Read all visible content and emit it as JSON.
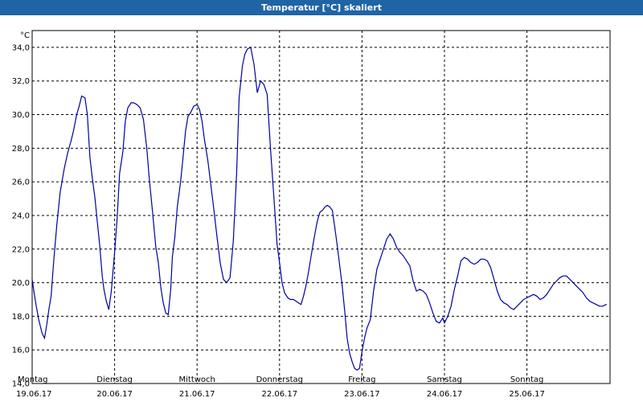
{
  "window": {
    "title": "Temperatur [°C] skaliert"
  },
  "chart_data": {
    "type": "line",
    "title": "Temperatur [°C] skaliert",
    "ylabel": "°C",
    "xlabel": "",
    "ylim": [
      14,
      35
    ],
    "yticks": [
      14,
      16,
      18,
      20,
      22,
      24,
      26,
      28,
      30,
      32,
      34
    ],
    "ytick_labels": [
      "14,0",
      "16,0",
      "18,0",
      "20,0",
      "22,0",
      "24,0",
      "26,0",
      "28,0",
      "30,0",
      "32,0",
      "34,0"
    ],
    "xlim": [
      0,
      7.0
    ],
    "x_unit": "days from 19.06.17 00:00",
    "days": [
      {
        "name": "Montag",
        "date": "19.06.17"
      },
      {
        "name": "Dienstag",
        "date": "20.06.17"
      },
      {
        "name": "Mittwoch",
        "date": "21.06.17"
      },
      {
        "name": "Donnerstag",
        "date": "22.06.17"
      },
      {
        "name": "Freitag",
        "date": "23.06.17"
      },
      {
        "name": "Samstag",
        "date": "24.06.17"
      },
      {
        "name": "Sonntag",
        "date": "25.06.17"
      }
    ],
    "grid": true,
    "grid_style": "dashed",
    "line_color": "#0000a0",
    "series": [
      {
        "x": [
          0.0,
          0.02,
          0.05,
          0.08,
          0.12,
          0.15,
          0.18,
          0.2,
          0.23,
          0.26,
          0.3,
          0.34,
          0.39,
          0.43,
          0.47,
          0.5,
          0.54,
          0.57,
          0.6,
          0.64,
          0.67,
          0.7,
          0.73,
          0.76,
          0.79,
          0.82,
          0.85,
          0.87,
          0.9,
          0.93,
          0.96,
          1.0,
          1.03,
          1.06,
          1.1,
          1.13,
          1.16,
          1.2,
          1.23,
          1.27,
          1.31,
          1.35,
          1.39,
          1.42,
          1.46,
          1.5,
          1.53,
          1.56,
          1.59,
          1.62,
          1.65,
          1.68,
          1.7,
          1.73,
          1.76,
          1.8,
          1.83,
          1.86,
          1.89,
          1.92,
          1.96,
          2.0,
          2.03,
          2.06,
          2.09,
          2.13,
          2.16,
          2.2,
          2.24,
          2.28,
          2.32,
          2.36,
          2.4,
          2.44,
          2.48,
          2.51,
          2.55,
          2.58,
          2.61,
          2.65,
          2.69,
          2.73,
          2.77,
          2.81,
          2.85,
          2.89,
          2.93,
          2.97,
          3.0,
          3.03,
          3.06,
          3.1,
          3.13,
          3.17,
          3.2,
          3.23,
          3.26,
          3.29,
          3.32,
          3.35,
          3.38,
          3.41,
          3.44,
          3.46,
          3.49,
          3.52,
          3.55,
          3.58,
          3.61,
          3.64,
          3.67,
          3.7,
          3.73,
          3.76,
          3.79,
          3.82,
          3.85,
          3.88,
          3.91,
          3.94,
          3.97,
          4.0,
          4.03,
          4.06,
          4.1,
          4.14,
          4.18,
          4.22,
          4.26,
          4.3,
          4.34,
          4.38,
          4.42,
          4.46,
          4.5,
          4.54,
          4.58,
          4.62,
          4.66,
          4.7,
          4.74,
          4.78,
          4.82,
          4.86,
          4.9,
          4.94,
          4.98,
          5.0,
          5.04,
          5.08,
          5.12,
          5.16,
          5.2,
          5.24,
          5.28,
          5.32,
          5.36,
          5.4,
          5.44,
          5.48,
          5.52,
          5.56,
          5.6,
          5.64,
          5.68,
          5.72,
          5.76,
          5.8,
          5.84,
          5.88,
          5.92,
          5.96,
          6.0,
          6.04,
          6.08,
          6.12,
          6.16,
          6.2,
          6.24,
          6.28,
          6.32,
          6.36,
          6.4,
          6.44,
          6.48,
          6.52,
          6.56,
          6.6,
          6.64,
          6.68,
          6.72,
          6.76,
          6.8,
          6.84,
          6.88,
          6.92,
          6.96,
          7.0
        ],
        "y": [
          20.2,
          19.5,
          18.6,
          17.8,
          17.0,
          16.7,
          17.6,
          18.3,
          19.2,
          21.2,
          23.5,
          25.4,
          26.8,
          27.7,
          28.4,
          29.0,
          30.0,
          30.5,
          31.1,
          31.0,
          30.0,
          27.5,
          26.2,
          25.1,
          23.6,
          22.2,
          20.4,
          19.6,
          18.9,
          18.4,
          19.5,
          21.8,
          23.8,
          26.5,
          27.8,
          29.6,
          30.4,
          30.7,
          30.7,
          30.6,
          30.4,
          29.7,
          28.0,
          26.2,
          24.2,
          22.1,
          21.2,
          19.7,
          18.8,
          18.2,
          18.1,
          19.6,
          21.5,
          22.7,
          24.5,
          26.0,
          27.5,
          29.0,
          29.9,
          30.1,
          30.5,
          30.6,
          30.3,
          29.6,
          28.5,
          27.3,
          26.1,
          24.5,
          22.8,
          21.2,
          20.2,
          20.0,
          20.3,
          22.5,
          26.5,
          31.0,
          32.9,
          33.6,
          33.9,
          34.0,
          33.0,
          31.3,
          32.0,
          31.8,
          31.2,
          28.0,
          25.2,
          22.3,
          21.2,
          20.0,
          19.4,
          19.1,
          19.0,
          19.0,
          18.9,
          18.8,
          18.7,
          19.2,
          19.8,
          20.6,
          21.5,
          22.4,
          23.2,
          23.7,
          24.2,
          24.3,
          24.5,
          24.6,
          24.5,
          24.3,
          23.3,
          22.2,
          21.0,
          19.8,
          18.3,
          16.7,
          15.8,
          15.3,
          14.9,
          14.8,
          14.9,
          15.9,
          16.7,
          17.3,
          17.8,
          19.5,
          20.8,
          21.4,
          22.0,
          22.6,
          22.9,
          22.6,
          22.1,
          21.8,
          21.6,
          21.3,
          21.0,
          20.1,
          19.5,
          19.6,
          19.5,
          19.3,
          18.8,
          18.2,
          17.7,
          17.6,
          17.9,
          17.6,
          18.0,
          18.6,
          19.6,
          20.4,
          21.3,
          21.5,
          21.4,
          21.2,
          21.1,
          21.2,
          21.4,
          21.4,
          21.3,
          20.9,
          20.2,
          19.5,
          19.0,
          18.8,
          18.7,
          18.5,
          18.4,
          18.6,
          18.8,
          19.0,
          19.1,
          19.2,
          19.3,
          19.2,
          19.0,
          19.1,
          19.3,
          19.6,
          19.9,
          20.1,
          20.3,
          20.4,
          20.4,
          20.2,
          20.0,
          19.8,
          19.6,
          19.4,
          19.1,
          18.9,
          18.8,
          18.7,
          18.6,
          18.6,
          18.7,
          18.7
        ]
      }
    ]
  }
}
